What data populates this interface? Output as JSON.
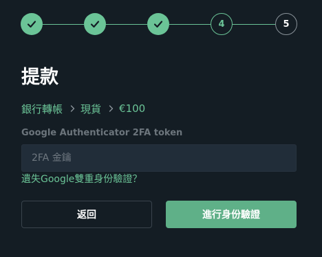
{
  "stepper": {
    "steps": [
      {
        "label": "",
        "state": "done",
        "icon": "checkmark-icon"
      },
      {
        "label": "",
        "state": "done",
        "icon": "checkmark-icon"
      },
      {
        "label": "",
        "state": "done",
        "icon": "checkmark-icon"
      },
      {
        "label": "4",
        "state": "active"
      },
      {
        "label": "5",
        "state": "pending"
      }
    ]
  },
  "page": {
    "title": "提款"
  },
  "breadcrumb": {
    "items": [
      "銀行轉帳",
      "現貨",
      "€100"
    ],
    "separator_icon": "chevron-right-icon"
  },
  "form": {
    "token_label": "Google Authenticator 2FA token",
    "token_value": "",
    "token_placeholder": "2FA 金鑰",
    "lost_link": "遺失Google雙重身份驗證？"
  },
  "actions": {
    "back_label": "返回",
    "verify_label": "進行身份驗證"
  },
  "colors": {
    "background": "#141d24",
    "accent": "#6bc497",
    "button_primary": "#5fb088",
    "input_background": "#212d39",
    "muted_text": "#6c757c"
  }
}
